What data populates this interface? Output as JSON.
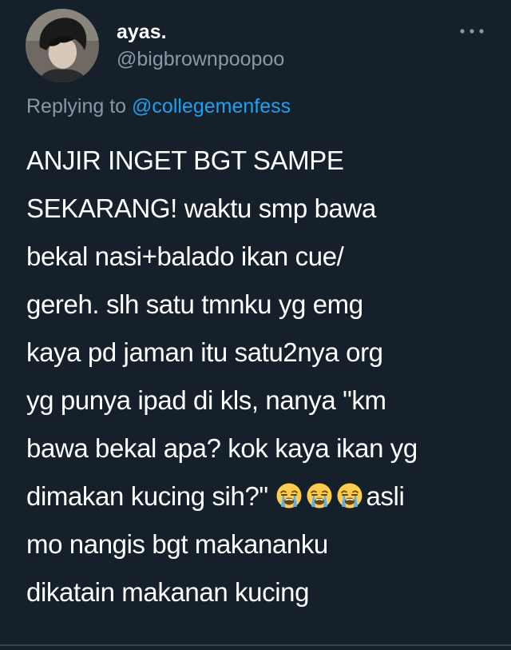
{
  "tweet": {
    "display_name": "ayas.",
    "handle": "@bigbrownpoopoo",
    "replying_prefix": "Replying to",
    "replying_mention": "@collegemenfess",
    "text_lines": [
      "ANJIR INGET BGT SAMPE",
      "SEKARANG! waktu smp bawa",
      "bekal nasi+balado ikan cue/",
      "gereh. slh satu tmnku yg emg",
      "kaya pd jaman itu satu2nya org",
      "yg punya ipad di kls, nanya \"km",
      "bawa bekal apa? kok kaya ikan yg",
      "dimakan kucing sih?\"",
      "asli",
      "mo nangis bgt makananku",
      "dikatain makanan kucing"
    ],
    "emoji": [
      "loudly-crying-face",
      "loudly-crying-face",
      "loudly-crying-face"
    ],
    "more_icon": "more-horizontal-icon",
    "colors": {
      "background": "#15202b",
      "text": "#ffffff",
      "secondary": "#8899a6",
      "link": "#1da1f2"
    }
  }
}
